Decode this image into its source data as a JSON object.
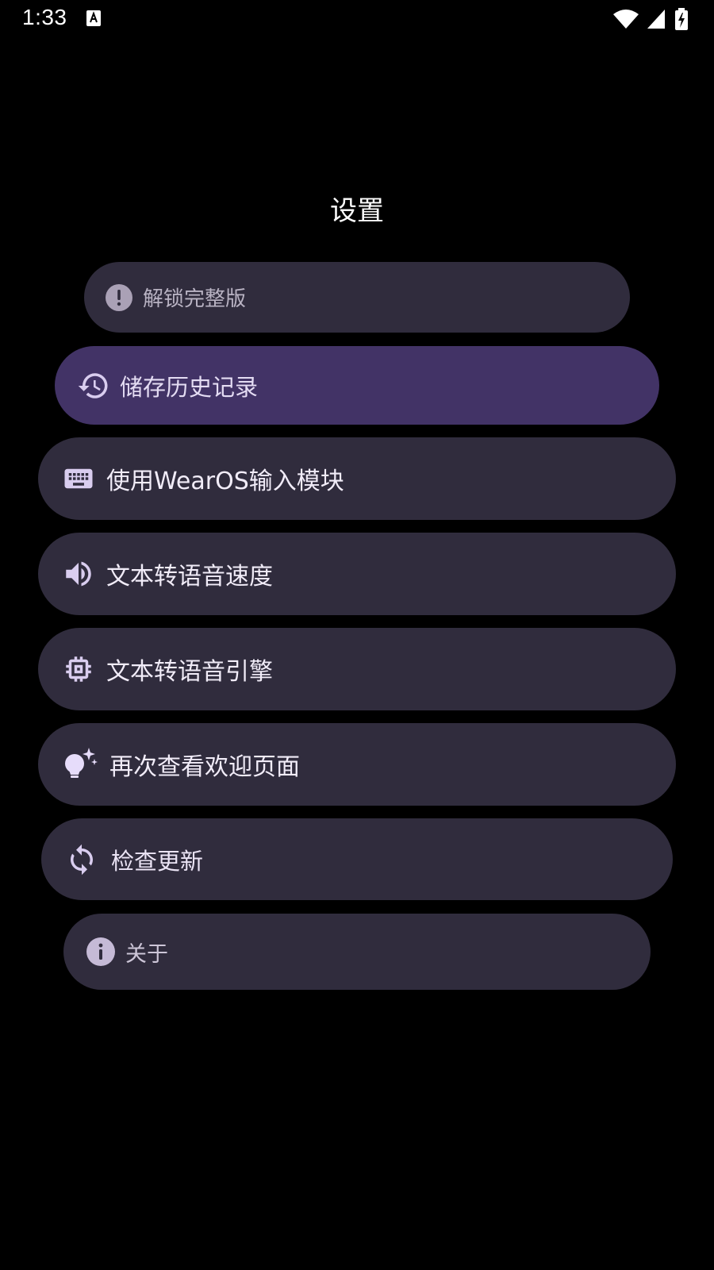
{
  "status_bar": {
    "time": "1:33",
    "notification_icon": "a-letter-icon",
    "wifi_icon": "wifi-icon",
    "signal_icon": "cell-signal-icon",
    "battery_icon": "battery-charging-icon"
  },
  "page": {
    "title": "设置"
  },
  "settings": {
    "items": [
      {
        "label": "解锁完整版",
        "icon": "exclamation-circle-icon"
      },
      {
        "label": "储存历史记录",
        "icon": "history-icon",
        "highlighted": true
      },
      {
        "label": "使用WearOS输入模块",
        "icon": "keyboard-icon"
      },
      {
        "label": "文本转语音速度",
        "icon": "volume-icon"
      },
      {
        "label": "文本转语音引擎",
        "icon": "chip-icon"
      },
      {
        "label": "再次查看欢迎页面",
        "icon": "lightbulb-sparkle-icon"
      },
      {
        "label": "检查更新",
        "icon": "sync-icon"
      },
      {
        "label": "关于",
        "icon": "info-icon"
      }
    ]
  },
  "colors": {
    "background": "#000000",
    "chip": "#302c3d",
    "chip_highlighted": "#423366",
    "icon": "#d8cdef",
    "text": "#f1ecf8"
  }
}
